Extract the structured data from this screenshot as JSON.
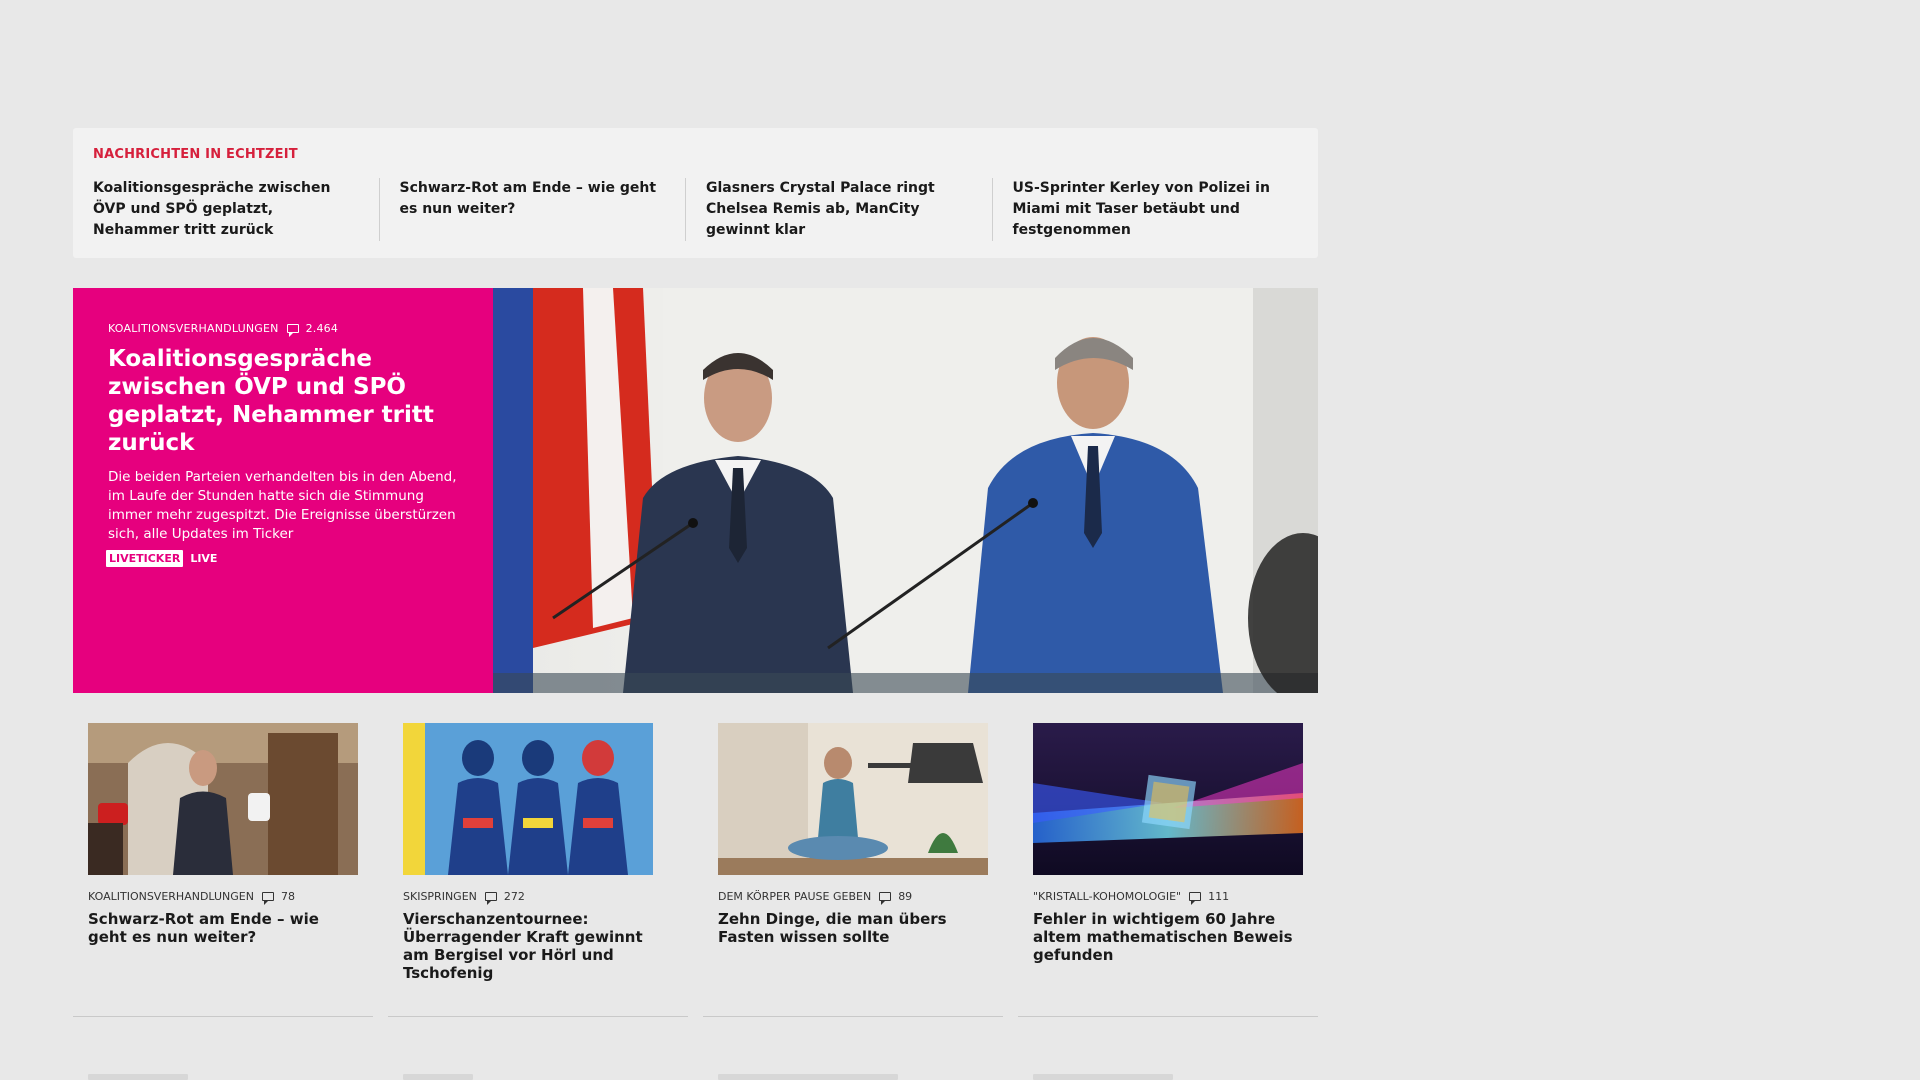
{
  "realtime": {
    "label": "NACHRICHTEN IN ECHTZEIT",
    "items": [
      "Koalitionsgespräche zwischen ÖVP und SPÖ geplatzt, Nehammer tritt zurück",
      "Schwarz-Rot am Ende – wie geht es nun weiter?",
      "Glasners Crystal Palace ringt Chelsea Remis ab, ManCity gewinnt klar",
      "US-Sprinter Kerley von Polizei in Miami mit Taser betäubt und festgenommen"
    ]
  },
  "hero": {
    "category": "KOALITIONSVERHANDLUNGEN",
    "comments": "2.464",
    "title": "Koalitionsgespräche zwischen ÖVP und SPÖ geplatzt, Nehammer tritt zurück",
    "description": "Die beiden Parteien verhandelten bis in den Abend, im Laufe der Stunden hatte sich die Stimmung immer mehr zugespitzt. Die Ereignisse überstürzen sich, alle Updates im Ticker",
    "badge": "LIVETICKER",
    "live": "LIVE",
    "accent_color": "#e6007e"
  },
  "teasers": [
    {
      "category": "KOALITIONSVERHANDLUNGEN",
      "comments": "78",
      "title": "Schwarz-Rot am Ende – wie geht es nun weiter?"
    },
    {
      "category": "SKISPRINGEN",
      "comments": "272",
      "title": "Vierschanzentournee: Überragender Kraft gewinnt am Bergisel vor Hörl und Tschofenig"
    },
    {
      "category": "DEM KÖRPER PAUSE GEBEN",
      "comments": "89",
      "title": "Zehn Dinge, die man übers Fasten wissen sollte"
    },
    {
      "category": "\"KRISTALL-KOHOMOLOGIE\"",
      "comments": "111",
      "title": "Fehler in wichtigem 60 Jahre altem mathematischen Beweis gefunden"
    }
  ],
  "colors": {
    "realtime_label": "#d6203c",
    "page_background": "#e8e8e8"
  }
}
